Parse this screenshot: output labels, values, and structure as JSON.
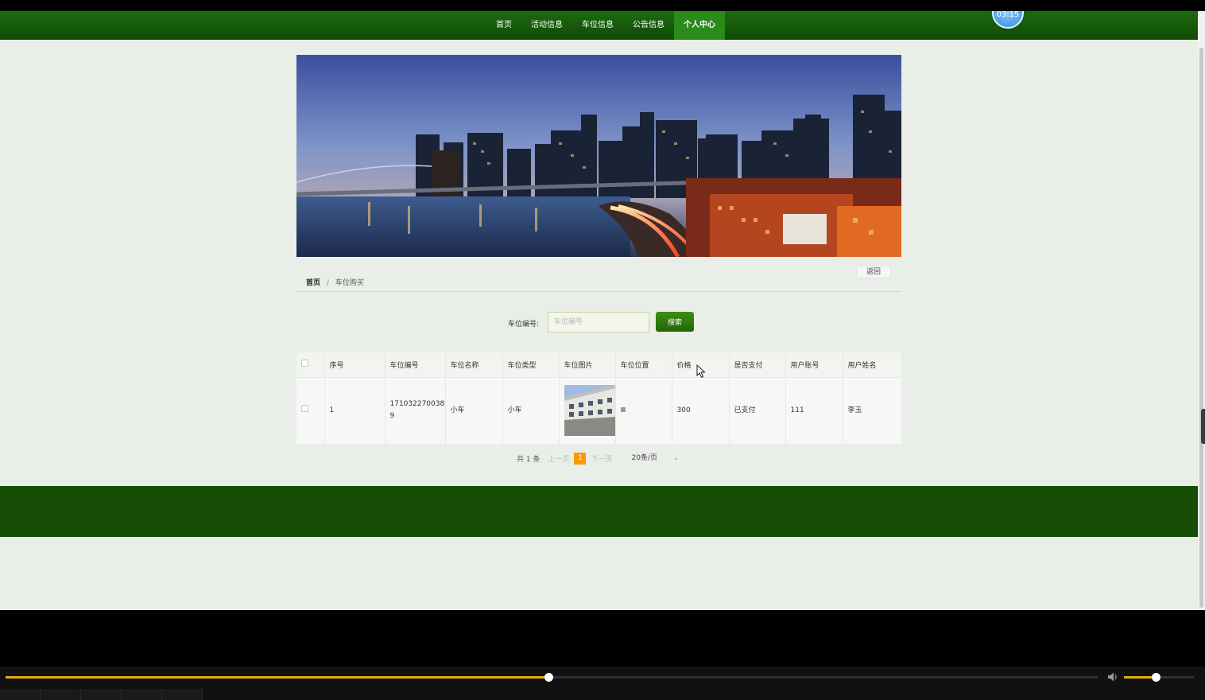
{
  "nav": {
    "items": [
      "首页",
      "活动信息",
      "车位信息",
      "公告信息",
      "个人中心"
    ],
    "active_index": 4,
    "timer": "03:15"
  },
  "breadcrumb": {
    "home": "首页",
    "separator": "/",
    "current": "车位购买"
  },
  "back_label": "返回",
  "search": {
    "label": "车位编号:",
    "placeholder": "车位编号",
    "button": "搜索"
  },
  "table": {
    "headers": [
      "序号",
      "车位编号",
      "车位名称",
      "车位类型",
      "车位图片",
      "车位位置",
      "价格",
      "是否支付",
      "用户账号",
      "用户姓名"
    ],
    "rows": [
      {
        "index": "1",
        "code_line1": "171032270038",
        "code_line2": "9",
        "name": "小车",
        "type": "小车",
        "price": "300",
        "paid": "已支付",
        "account": "111",
        "username": "李玉"
      }
    ]
  },
  "pagination": {
    "total": "共 1 条",
    "prev": "上一页",
    "current": "1",
    "next": "下一页",
    "page_size": "20条/页"
  },
  "player": {
    "progress": 0.497,
    "volume": 0.45
  },
  "colors": {
    "nav": "#165c0a",
    "footer": "#154d05",
    "accent": "#e3b00b",
    "page_badge": "#ff9800"
  }
}
